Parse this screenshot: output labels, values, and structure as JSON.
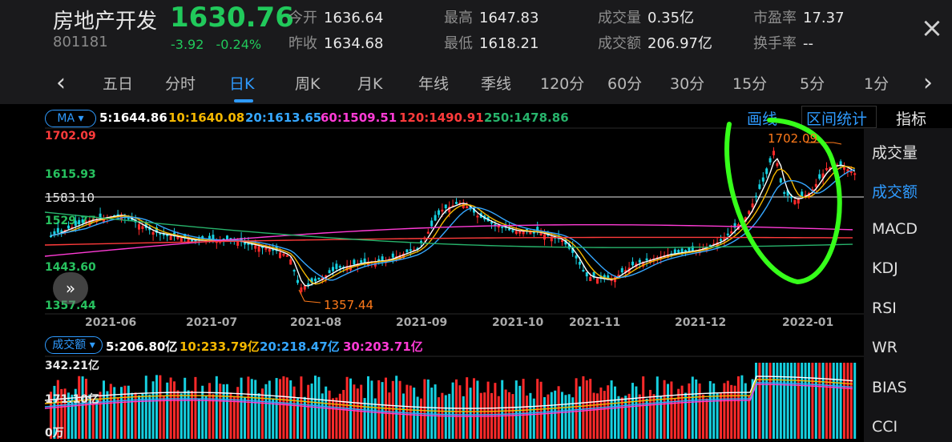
{
  "header": {
    "name": "房地产开发",
    "code": "801181",
    "price": "1630.76",
    "change": "-3.92",
    "change_pct": "-0.24%",
    "stats": [
      {
        "k": "今开",
        "v": "1636.64"
      },
      {
        "k": "昨收",
        "v": "1634.68"
      },
      {
        "k": "最高",
        "v": "1647.83"
      },
      {
        "k": "最低",
        "v": "1618.21"
      },
      {
        "k": "成交量",
        "v": "0.35亿"
      },
      {
        "k": "成交额",
        "v": "206.97亿"
      },
      {
        "k": "市盈率",
        "v": "17.37"
      },
      {
        "k": "换手率",
        "v": "--"
      }
    ],
    "close_icon": "×"
  },
  "tabs": [
    "五日",
    "分时",
    "日K",
    "周K",
    "月K",
    "年线",
    "季线",
    "120分",
    "60分",
    "30分",
    "15分",
    "5分",
    "1分"
  ],
  "active_tab": "日K",
  "ma": {
    "badge": "MA",
    "items": [
      {
        "label": "5:1644.86",
        "color": "#ffffff"
      },
      {
        "label": "10:1640.08",
        "color": "#f5b800"
      },
      {
        "label": "20:1613.65",
        "color": "#35a7ff"
      },
      {
        "label": "60:1509.51",
        "color": "#ff3bd6"
      },
      {
        "label": "120:1490.91",
        "color": "#ff3b3b"
      },
      {
        "label": "250:1478.86",
        "color": "#27b36b"
      }
    ]
  },
  "price_axis": {
    "max": "1702.09",
    "l1": "1615.93",
    "ref": "1583.10",
    "l2": "1529.77",
    "l3": "1443.60",
    "min": "1357.44"
  },
  "annotations": {
    "high": "1702.09",
    "low": "1357.44"
  },
  "dates": [
    "2021-06",
    "2021-07",
    "2021-08",
    "2021-09",
    "2021-10",
    "2021-11",
    "2021-12",
    "2022-01"
  ],
  "volume": {
    "badge": "成交额",
    "items": [
      {
        "label": "5:206.80亿",
        "color": "#ffffff"
      },
      {
        "label": "10:233.79亿",
        "color": "#f5b800"
      },
      {
        "label": "20:218.47亿",
        "color": "#35a7ff"
      },
      {
        "label": "30:203.71亿",
        "color": "#ff3bd6"
      }
    ],
    "max": "342.21亿",
    "mid": "171.10亿",
    "zero": "0万"
  },
  "panel": {
    "draw": "画线",
    "range": "区间统计",
    "indicators_title": "指标",
    "items": [
      "成交量",
      "成交额",
      "MACD",
      "KDJ",
      "RSI",
      "WR",
      "BIAS",
      "CCI"
    ],
    "active": "成交额"
  },
  "colors": {
    "up": "#ff2a2a",
    "down": "#16d0e0",
    "accent": "#2f9bff",
    "price_down": "#21c95b",
    "highlight": "#36ff1a"
  }
}
